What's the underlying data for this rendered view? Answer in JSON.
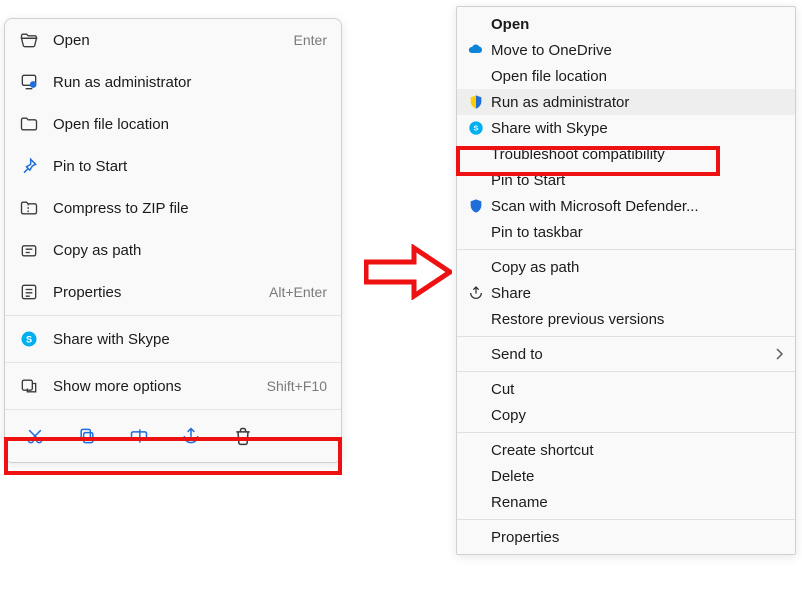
{
  "menu1": {
    "items": [
      {
        "icon": "open-folder-icon",
        "label": "Open",
        "accel": "Enter"
      },
      {
        "icon": "admin-icon",
        "label": "Run as administrator",
        "accel": ""
      },
      {
        "icon": "folder-icon",
        "label": "Open file location",
        "accel": ""
      },
      {
        "icon": "pin-icon",
        "label": "Pin to Start",
        "accel": ""
      },
      {
        "icon": "zip-icon",
        "label": "Compress to ZIP file",
        "accel": ""
      },
      {
        "icon": "copypath-icon",
        "label": "Copy as path",
        "accel": ""
      },
      {
        "icon": "properties-icon",
        "label": "Properties",
        "accel": "Alt+Enter"
      }
    ],
    "group2": [
      {
        "icon": "skype-icon",
        "label": "Share with Skype",
        "accel": ""
      }
    ],
    "group3": [
      {
        "icon": "moreoptions-icon",
        "label": "Show more options",
        "accel": "Shift+F10"
      }
    ],
    "toolbar_icons": [
      "cut-icon",
      "copy-icon",
      "rename-icon",
      "share-icon",
      "delete-icon"
    ]
  },
  "menu2": {
    "items": [
      {
        "icon": "",
        "label": "Open",
        "bold": true,
        "submenu": false
      },
      {
        "icon": "onedrive-icon",
        "label": "Move to OneDrive",
        "bold": false,
        "submenu": false
      },
      {
        "icon": "",
        "label": "Open file location",
        "bold": false,
        "submenu": false
      },
      {
        "icon": "shield-yellowblue-icon",
        "label": "Run as administrator",
        "bold": false,
        "submenu": false,
        "hovered": true
      },
      {
        "icon": "skype-icon",
        "label": "Share with Skype",
        "bold": false,
        "submenu": false
      },
      {
        "icon": "",
        "label": "Troubleshoot compatibility",
        "bold": false,
        "submenu": false
      },
      {
        "icon": "",
        "label": "Pin to Start",
        "bold": false,
        "submenu": false
      },
      {
        "icon": "shield-blue-icon",
        "label": "Scan with Microsoft Defender...",
        "bold": false,
        "submenu": false
      },
      {
        "icon": "",
        "label": "Pin to taskbar",
        "bold": false,
        "submenu": false
      },
      {
        "sep": true
      },
      {
        "icon": "",
        "label": "Copy as path",
        "bold": false,
        "submenu": false
      },
      {
        "icon": "share-icon",
        "label": "Share",
        "bold": false,
        "submenu": false
      },
      {
        "icon": "",
        "label": "Restore previous versions",
        "bold": false,
        "submenu": false
      },
      {
        "sep": true
      },
      {
        "icon": "",
        "label": "Send to",
        "bold": false,
        "submenu": true
      },
      {
        "sep": true
      },
      {
        "icon": "",
        "label": "Cut",
        "bold": false,
        "submenu": false
      },
      {
        "icon": "",
        "label": "Copy",
        "bold": false,
        "submenu": false
      },
      {
        "sep": true
      },
      {
        "icon": "",
        "label": "Create shortcut",
        "bold": false,
        "submenu": false
      },
      {
        "icon": "",
        "label": "Delete",
        "bold": false,
        "submenu": false
      },
      {
        "icon": "",
        "label": "Rename",
        "bold": false,
        "submenu": false
      },
      {
        "sep": true
      },
      {
        "icon": "",
        "label": "Properties",
        "bold": false,
        "submenu": false
      }
    ]
  },
  "annotations": {
    "highlight1": "show-more-options-highlight",
    "highlight2": "troubleshoot-compatibility-highlight",
    "arrow": "flow-arrow"
  }
}
